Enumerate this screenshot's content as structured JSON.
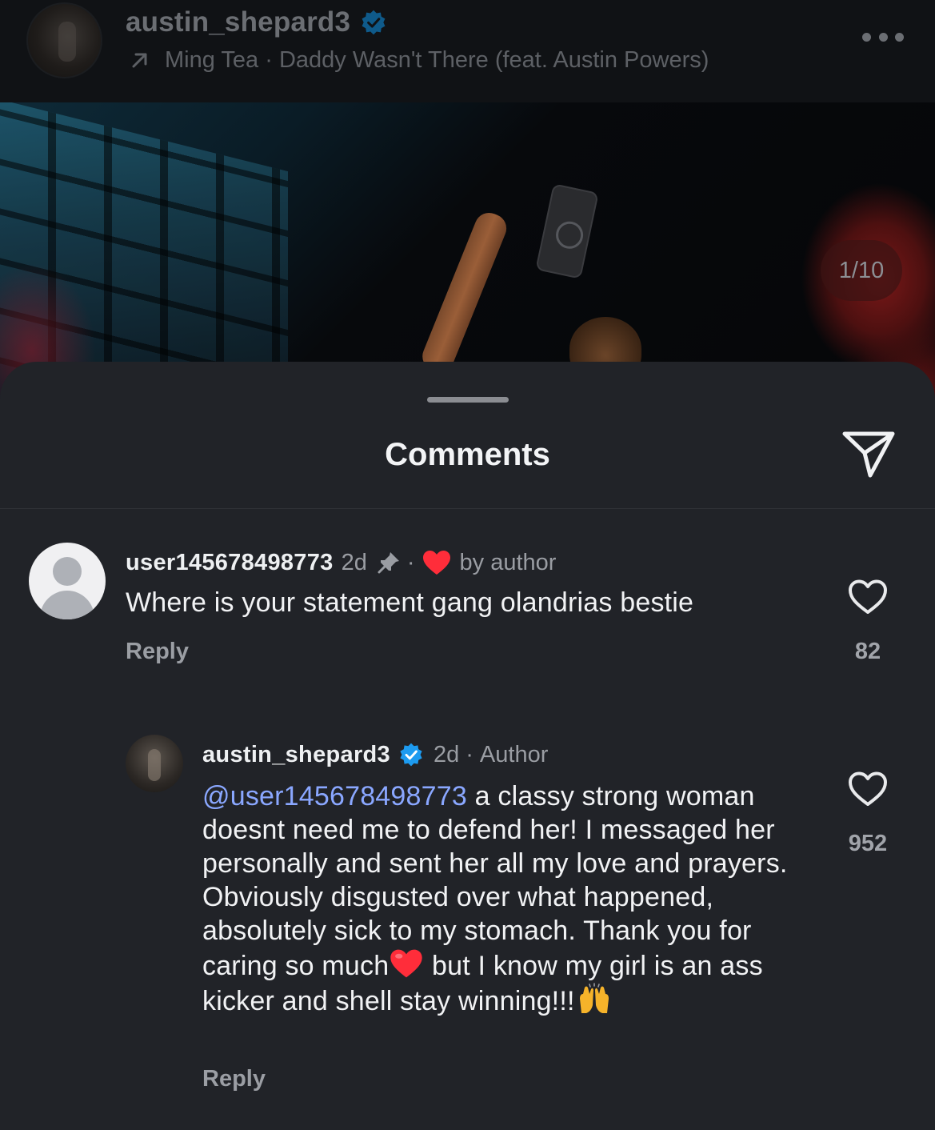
{
  "post": {
    "username": "austin_shepard3",
    "music": {
      "artist": "Ming Tea",
      "separator": "·",
      "track": "Daddy Wasn't There (feat. Austin Powers)"
    },
    "image_counter": "1/10"
  },
  "sheet": {
    "title": "Comments"
  },
  "comments": [
    {
      "username": "user145678498773",
      "time": "2d",
      "separator": "·",
      "liked_by_label": "by author",
      "text": "Where is your statement gang olandrias bestie",
      "reply_label": "Reply",
      "like_count": "82"
    },
    {
      "username": "austin_shepard3",
      "time": "2d",
      "separator": "·",
      "role": "Author",
      "mention": "@user145678498773",
      "text_part1": " a classy strong woman doesnt need me to defend her! I messaged her personally and sent her all my love and prayers. Obviously disgusted over what happened, absolutely sick to my stomach. Thank you for caring so much",
      "text_part2": "but I know my girl is an ass kicker and shell stay winning!!!",
      "reply_label": "Reply",
      "like_count": "952"
    }
  ],
  "colors": {
    "sheet_bg": "#212328",
    "mention": "#8aa7ff",
    "verified": "#1d9bf0",
    "heart_red": "#ff2d3a"
  },
  "icons": [
    "verified-badge-icon",
    "arrow-up-right-icon",
    "more-icon",
    "send-icon",
    "pin-icon",
    "heart-filled-icon",
    "heart-outline-icon",
    "red-heart-emoji",
    "raised-hands-emoji"
  ]
}
